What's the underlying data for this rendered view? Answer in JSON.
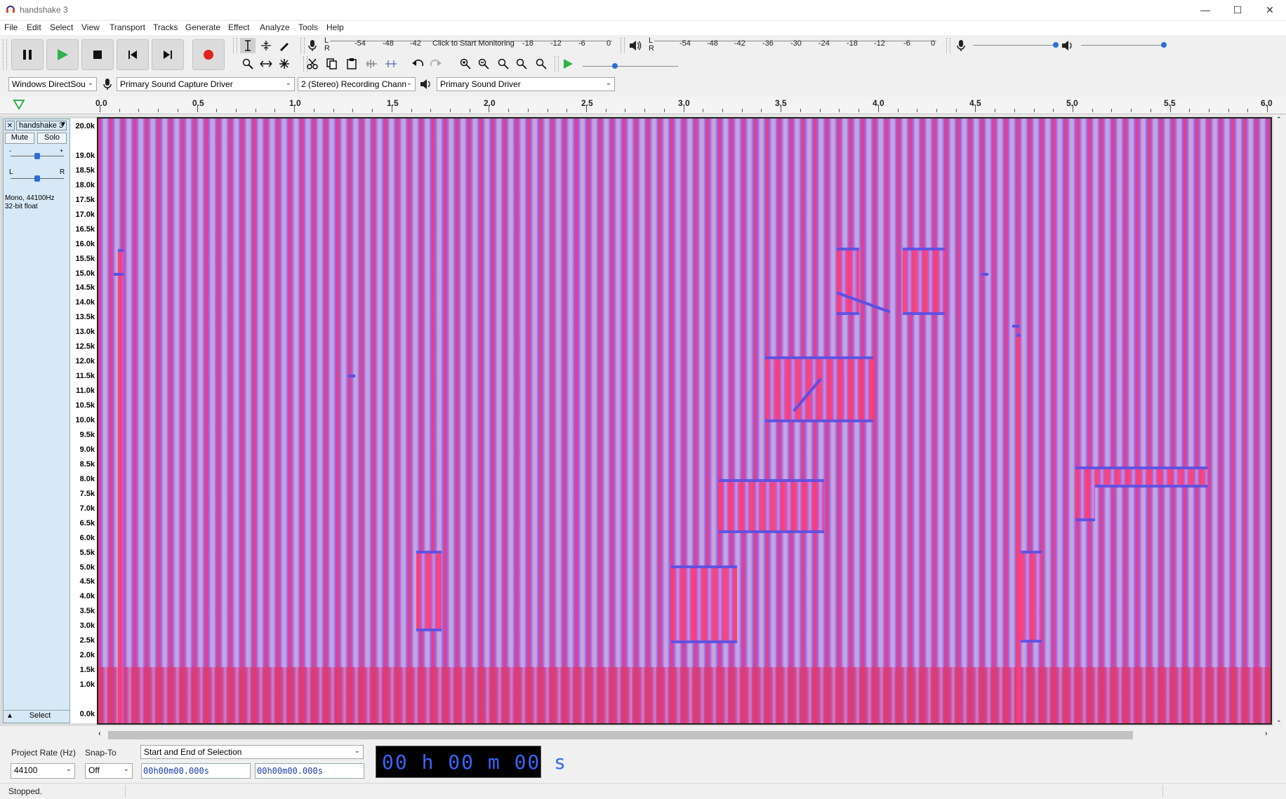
{
  "window": {
    "title": "handshake 3"
  },
  "menu": [
    "File",
    "Edit",
    "Select",
    "View",
    "Transport",
    "Tracks",
    "Generate",
    "Effect",
    "Analyze",
    "Tools",
    "Help"
  ],
  "meters": {
    "record_ticks": [
      "-54",
      "-48",
      "-42",
      "-18",
      "-12",
      "-6",
      "0"
    ],
    "monitor_prompt": "Click to Start Monitoring",
    "play_ticks": [
      "-54",
      "-48",
      "-42",
      "-36",
      "-30",
      "-24",
      "-18",
      "-12",
      "-6",
      "0"
    ],
    "lr": [
      "L",
      "R"
    ]
  },
  "devices": {
    "host": "Windows DirectSou",
    "input": "Primary Sound Capture Driver",
    "channels": "2 (Stereo) Recording Chann",
    "output": "Primary Sound Driver"
  },
  "ruler": [
    "0.0",
    "0.5",
    "1.0",
    "1.5",
    "2.0",
    "2.5",
    "3.0",
    "3.5",
    "4.0",
    "4.5",
    "5.0",
    "5.5",
    "6.0"
  ],
  "track": {
    "name": "handshake 3",
    "mute": "Mute",
    "solo": "Solo",
    "gain_minus": "-",
    "gain_plus": "+",
    "pan_left": "L",
    "pan_right": "R",
    "info1": "Mono, 44100Hz",
    "info2": "32-bit float",
    "select": "Select",
    "freq_labels": [
      "20.0k",
      "19.0k",
      "18.5k",
      "18.0k",
      "17.5k",
      "17.0k",
      "16.5k",
      "16.0k",
      "15.5k",
      "15.0k",
      "14.5k",
      "14.0k",
      "13.5k",
      "13.0k",
      "12.5k",
      "12.0k",
      "11.5k",
      "11.0k",
      "10.5k",
      "10.0k",
      "9.5k",
      "9.0k",
      "8.5k",
      "8.0k",
      "7.5k",
      "7.0k",
      "6.5k",
      "6.0k",
      "5.5k",
      "5.0k",
      "4.5k",
      "4.0k",
      "3.5k",
      "3.0k",
      "2.5k",
      "2.0k",
      "1.5k",
      "1.0k",
      "0.0k"
    ]
  },
  "selection": {
    "rate_label": "Project Rate (Hz)",
    "rate_value": "44100",
    "snap_label": "Snap-To",
    "snap_value": "Off",
    "mode": "Start and End of Selection",
    "start_time": "00h00m00.000s",
    "end_time": "00h00m00.000s",
    "big_time": "00 h 00 m 00 s"
  },
  "status": "Stopped."
}
